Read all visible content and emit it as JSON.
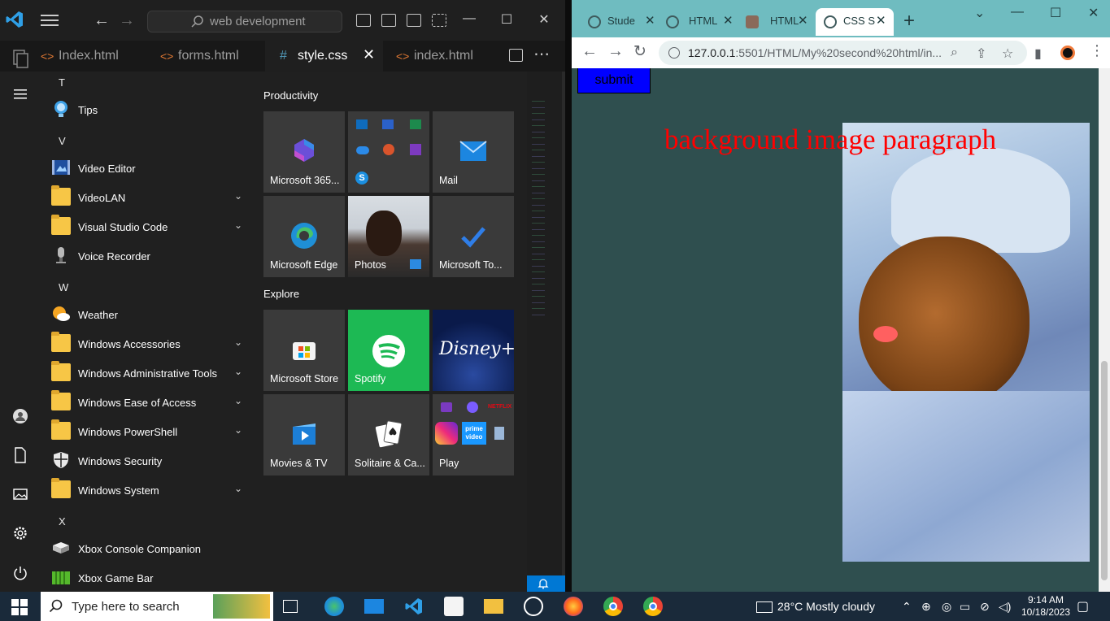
{
  "vscode": {
    "search_text": "web development",
    "tabs": [
      {
        "label": "Index.html",
        "icon": "html-file-icon"
      },
      {
        "label": "forms.html",
        "icon": "html-file-icon"
      },
      {
        "label": "style.css",
        "icon": "css-file-icon"
      },
      {
        "label": "index.html",
        "icon": "html-file-icon"
      }
    ],
    "active_tab": "style.css"
  },
  "start_menu": {
    "rail_icons": [
      "hamburger-menu-icon",
      "user-account-icon",
      "documents-icon",
      "pictures-icon",
      "settings-icon",
      "power-icon"
    ],
    "letters": {
      "t": "T",
      "v": "V",
      "w": "W",
      "x": "X"
    },
    "apps": [
      {
        "label": "Tips",
        "icon": "lightbulb-icon",
        "expandable": false
      },
      {
        "label": "Video Editor",
        "icon": "video-editor-icon",
        "expandable": false
      },
      {
        "label": "VideoLAN",
        "icon": "folder-icon",
        "expandable": true
      },
      {
        "label": "Visual Studio Code",
        "icon": "folder-icon",
        "expandable": true
      },
      {
        "label": "Voice Recorder",
        "icon": "microphone-icon",
        "expandable": false
      },
      {
        "label": "Weather",
        "icon": "weather-icon",
        "expandable": false
      },
      {
        "label": "Windows Accessories",
        "icon": "folder-icon",
        "expandable": true
      },
      {
        "label": "Windows Administrative Tools",
        "icon": "folder-icon",
        "expandable": true
      },
      {
        "label": "Windows Ease of Access",
        "icon": "folder-icon",
        "expandable": true
      },
      {
        "label": "Windows PowerShell",
        "icon": "folder-icon",
        "expandable": true
      },
      {
        "label": "Windows Security",
        "icon": "shield-icon",
        "expandable": false
      },
      {
        "label": "Windows System",
        "icon": "folder-icon",
        "expandable": true
      },
      {
        "label": "Xbox Console Companion",
        "icon": "xbox-controller-icon",
        "expandable": false
      },
      {
        "label": "Xbox Game Bar",
        "icon": "xbox-game-bar-icon",
        "expandable": false
      }
    ],
    "sections": {
      "productivity": "Productivity",
      "explore": "Explore"
    },
    "tiles": {
      "m365": "Microsoft 365...",
      "mail": "Mail",
      "edge": "Microsoft Edge",
      "photos": "Photos",
      "todo": "Microsoft To...",
      "store": "Microsoft Store",
      "spotify": "Spotify",
      "disney": "Disney+",
      "movies": "Movies & TV",
      "solitaire": "Solitaire & Ca...",
      "play": "Play"
    },
    "colors": {
      "spotify_green": "#1db954",
      "disney_blue": "#0a1a4a"
    }
  },
  "browser": {
    "tabs": [
      {
        "label": "Stude"
      },
      {
        "label": "HTML"
      },
      {
        "label": "HTML"
      },
      {
        "label": "CSS S"
      }
    ],
    "active_tab_index": 3,
    "url_host": "127.0.0.1",
    "url_rest": ":5501/HTML/My%20second%20html/in...",
    "page": {
      "button_label": "submit",
      "bg_text": "background image paragraph",
      "page_bg": "#2f4f4f",
      "text_color": "#ff0000"
    }
  },
  "taskbar": {
    "search_placeholder": "Type here to search",
    "weather": "28°C  Mostly cloudy",
    "time": "9:14 AM",
    "date": "10/18/2023",
    "apps": [
      "task-view-icon",
      "edge-icon",
      "mail-icon",
      "vscode-icon",
      "store-icon",
      "file-explorer-icon",
      "media-player-icon",
      "firefox-icon",
      "chrome-icon",
      "chrome-profile-icon"
    ]
  }
}
